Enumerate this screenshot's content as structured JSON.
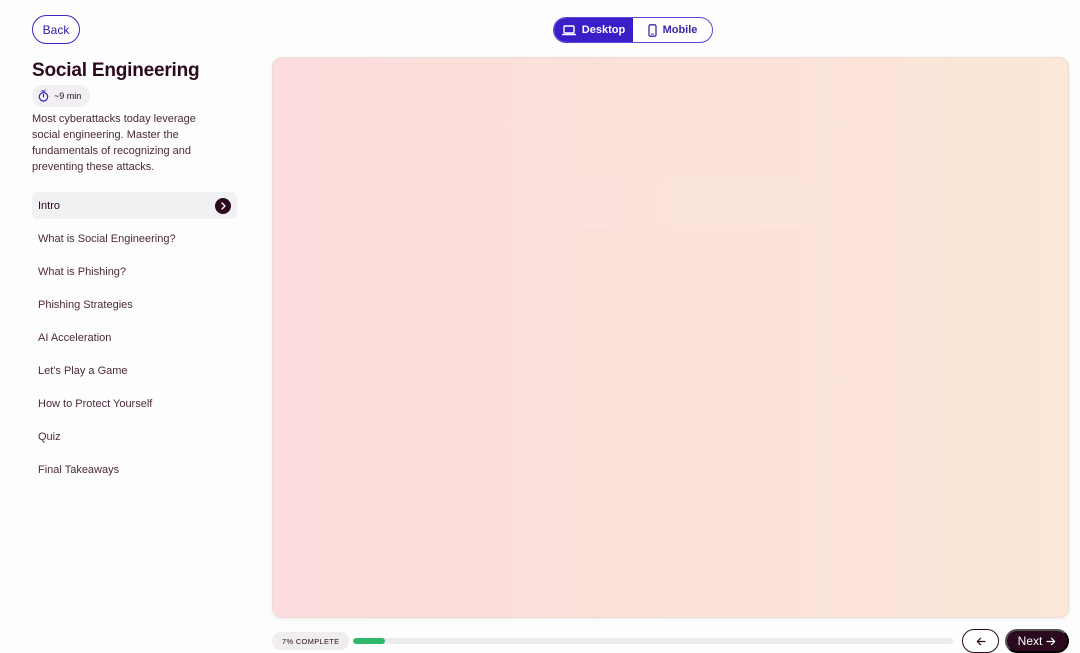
{
  "header": {
    "back_label": "Back",
    "view_toggle": {
      "desktop_label": "Desktop",
      "mobile_label": "Mobile",
      "selected": "Desktop"
    }
  },
  "course": {
    "title": "Social Engineering",
    "duration": "~9 min",
    "description": "Most cyberattacks today leverage social engineering. Master the fundamentals of recognizing and preventing these attacks."
  },
  "sections": [
    {
      "label": "Intro",
      "active": true
    },
    {
      "label": "What is Social Engineering?",
      "active": false
    },
    {
      "label": "What is Phishing?",
      "active": false
    },
    {
      "label": "Phishing Strategies",
      "active": false
    },
    {
      "label": "AI Acceleration",
      "active": false
    },
    {
      "label": "Let's Play a Game",
      "active": false
    },
    {
      "label": "How to Protect Yourself",
      "active": false
    },
    {
      "label": "Quiz",
      "active": false
    },
    {
      "label": "Final Takeaways",
      "active": false
    }
  ],
  "footer": {
    "progress_label": "7% COMPLETE",
    "progress_percent": 7,
    "next_label": "Next"
  },
  "colors": {
    "brand_dark": "#2b0a1e",
    "accent_purple": "#3a1fc9",
    "progress_green": "#2fb86a"
  },
  "icons": {
    "back": "none",
    "desktop": "laptop-icon",
    "mobile": "phone-icon",
    "duration": "stopwatch-icon",
    "active_section": "chevron-right-icon",
    "prev": "arrow-left-icon",
    "next": "arrow-right-icon"
  }
}
